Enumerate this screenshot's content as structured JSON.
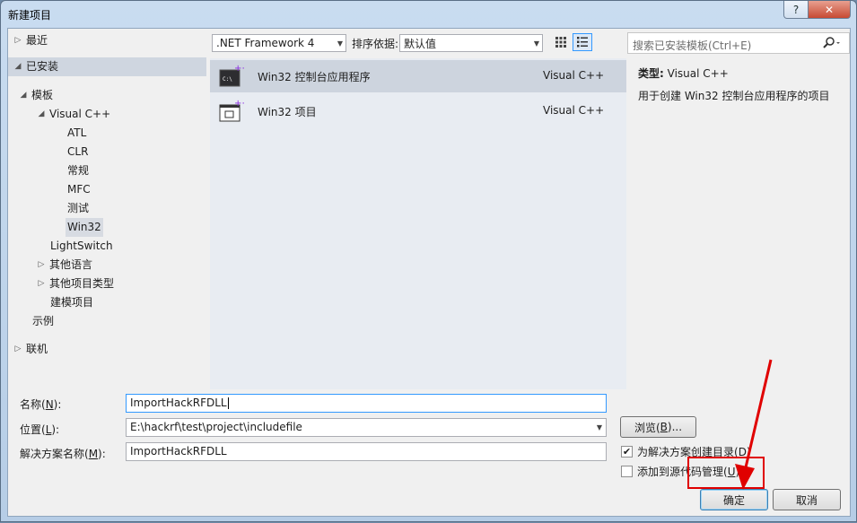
{
  "window": {
    "title": "新建项目",
    "help_label": "?",
    "close_label": "✕"
  },
  "tree": {
    "recent": "最近",
    "installed": "已安装",
    "templates": "模板",
    "visual_cpp": "Visual C++",
    "atl": "ATL",
    "clr": "CLR",
    "general": "常规",
    "mfc": "MFC",
    "test": "测试",
    "win32": "Win32",
    "lightswitch": "LightSwitch",
    "other_languages": "其他语言",
    "other_project_types": "其他项目类型",
    "modeling_projects": "建模项目",
    "samples": "示例",
    "online": "联机"
  },
  "toolbar": {
    "framework": ".NET Framework 4",
    "sort_label": "排序依据:",
    "sort_value": "默认值"
  },
  "templates": [
    {
      "name": "Win32 控制台应用程序",
      "language": "Visual C++"
    },
    {
      "name": "Win32 项目",
      "language": "Visual C++"
    }
  ],
  "search": {
    "placeholder": "搜索已安装模板(Ctrl+E)"
  },
  "details": {
    "type_label": "类型:",
    "type_value": "Visual C++",
    "description": "用于创建 Win32 控制台应用程序的项目"
  },
  "form": {
    "name_label": "名称(",
    "name_key": "N",
    "name_label_end": "):",
    "name_value": "ImportHackRFDLL",
    "location_label": "位置(",
    "location_key": "L",
    "location_label_end": "):",
    "location_value": "E:\\hackrf\\test\\project\\includefile",
    "solution_label": "解决方案名称(",
    "solution_key": "M",
    "solution_label_end": "):",
    "solution_value": "ImportHackRFDLL",
    "browse_label": "浏览(",
    "browse_key": "B",
    "browse_label_end": ")...",
    "create_dir_label": "为解决方案创建目录(",
    "create_dir_key": "D",
    "create_dir_end": ")",
    "create_dir_checked": true,
    "add_source_label": "添加到源代码管理(",
    "add_source_key": "U",
    "add_source_end": ")",
    "add_source_checked": false,
    "ok_label": "确定",
    "cancel_label": "取消"
  },
  "colors": {
    "annotation": "#e00000",
    "selection": "#cdd4de",
    "accent_border": "#3399ff"
  }
}
